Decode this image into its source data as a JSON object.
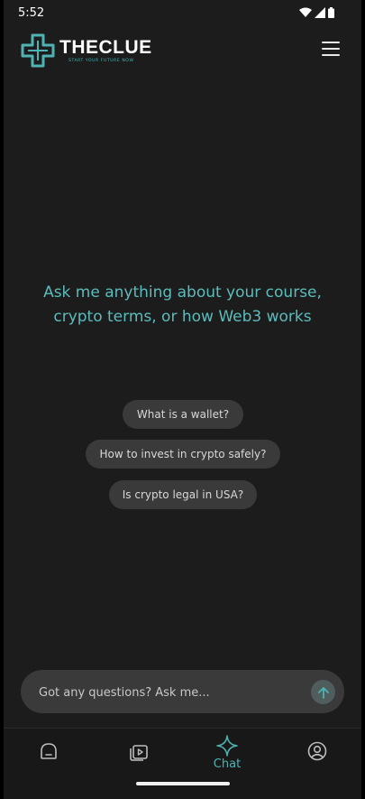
{
  "status_bar": {
    "time": "5:52"
  },
  "header": {
    "logo_title": "THECLUE",
    "logo_tagline": "START YOUR FUTURE NOW"
  },
  "chat": {
    "prompt_line1": "Ask me anything about your course,",
    "prompt_line2": "crypto terms, or how Web3 works",
    "suggestions": [
      "What is a wallet?",
      "How to invest in crypto safely?",
      "Is crypto legal in USA?"
    ],
    "input_placeholder": "Got any questions? Ask me..."
  },
  "bottom_nav": {
    "items": [
      {
        "icon": "home-icon",
        "label": ""
      },
      {
        "icon": "video-library-icon",
        "label": ""
      },
      {
        "icon": "sparkle-icon",
        "label": "Chat"
      },
      {
        "icon": "profile-icon",
        "label": ""
      }
    ],
    "active_index": 2
  },
  "colors": {
    "background": "#1c1c1c",
    "accent": "#4fb3b3",
    "chip": "#3a3a3a"
  }
}
